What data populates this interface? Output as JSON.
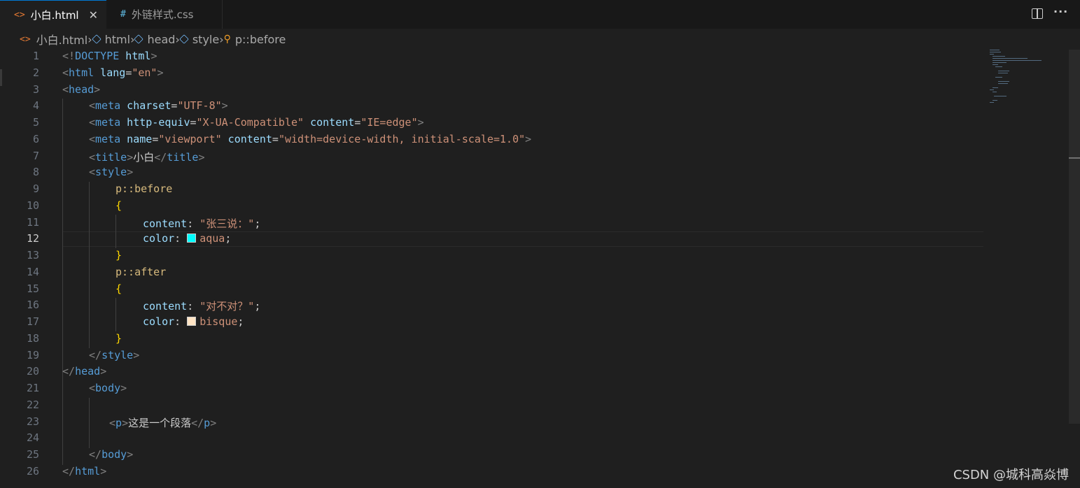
{
  "tabs": [
    {
      "label": "小白.html",
      "icon": "html-file-icon",
      "active": true,
      "close": "✕"
    },
    {
      "label": "外链样式.css",
      "icon": "css-file-icon",
      "active": false
    }
  ],
  "breadcrumb": [
    "小白.html",
    "html",
    "head",
    "style",
    "p::before"
  ],
  "line_numbers": [
    "1",
    "2",
    "3",
    "4",
    "5",
    "6",
    "7",
    "8",
    "9",
    "10",
    "11",
    "12",
    "13",
    "14",
    "15",
    "16",
    "17",
    "18",
    "19",
    "20",
    "21",
    "22",
    "23",
    "24",
    "25",
    "26"
  ],
  "current_line": "12",
  "code": {
    "l1": {
      "a": "<!",
      "b": "DOCTYPE",
      "c": " html",
      "d": ">"
    },
    "l2": {
      "a": "<",
      "b": "html",
      "c": " lang",
      "d": "=",
      "e": "\"en\"",
      "f": ">"
    },
    "l3": {
      "a": "<",
      "b": "head",
      "c": ">"
    },
    "l4": {
      "a": "<",
      "b": "meta",
      "c": " charset",
      "d": "=",
      "e": "\"UTF-8\"",
      "f": ">"
    },
    "l5": {
      "a": "<",
      "b": "meta",
      "c": " http-equiv",
      "d": "=",
      "e": "\"X-UA-Compatible\"",
      "f": " content",
      "g": "=",
      "h": "\"IE=edge\"",
      "i": ">"
    },
    "l6": {
      "a": "<",
      "b": "meta",
      "c": " name",
      "d": "=",
      "e": "\"viewport\"",
      "f": " content",
      "g": "=",
      "h": "\"width=device-width, initial-scale=1.0\"",
      "i": ">"
    },
    "l7": {
      "a": "<",
      "b": "title",
      "c": ">",
      "d": "小白",
      "e": "</",
      "f": "title",
      "g": ">"
    },
    "l8": {
      "a": "<",
      "b": "style",
      "c": ">"
    },
    "l9": {
      "a": "p::before"
    },
    "l10": {
      "a": "{"
    },
    "l11": {
      "a": "content",
      "b": ": ",
      "c": "\"张三说：\"",
      "d": ";"
    },
    "l12": {
      "a": "color",
      "b": ": ",
      "c": "aqua",
      "d": ";",
      "swatch": "#00ffff"
    },
    "l13": {
      "a": "}"
    },
    "l14": {
      "a": "p::after"
    },
    "l15": {
      "a": "{"
    },
    "l16": {
      "a": "content",
      "b": ": ",
      "c": "\"对不对？\"",
      "d": ";"
    },
    "l17": {
      "a": "color",
      "b": ": ",
      "c": "bisque",
      "d": ";",
      "swatch": "#ffe4c4"
    },
    "l18": {
      "a": "}"
    },
    "l19": {
      "a": "</",
      "b": "style",
      "c": ">"
    },
    "l20": {
      "a": "</",
      "b": "head",
      "c": ">"
    },
    "l21": {
      "a": "<",
      "b": "body",
      "c": ">"
    },
    "l23": {
      "a": "<",
      "b": "p",
      "c": ">",
      "d": "这是一个段落",
      "e": "</",
      "f": "p",
      "g": ">"
    },
    "l25": {
      "a": "</",
      "b": "body",
      "c": ">"
    },
    "l26": {
      "a": "</",
      "b": "html",
      "c": ">"
    }
  },
  "watermark": "CSDN @城科高焱博",
  "colors": {
    "accent": "#0078d4",
    "background": "#1f1f1f",
    "tag": "#569cd6",
    "attribute": "#9cdcfe",
    "string": "#ce9178",
    "selector": "#d7ba7d"
  }
}
